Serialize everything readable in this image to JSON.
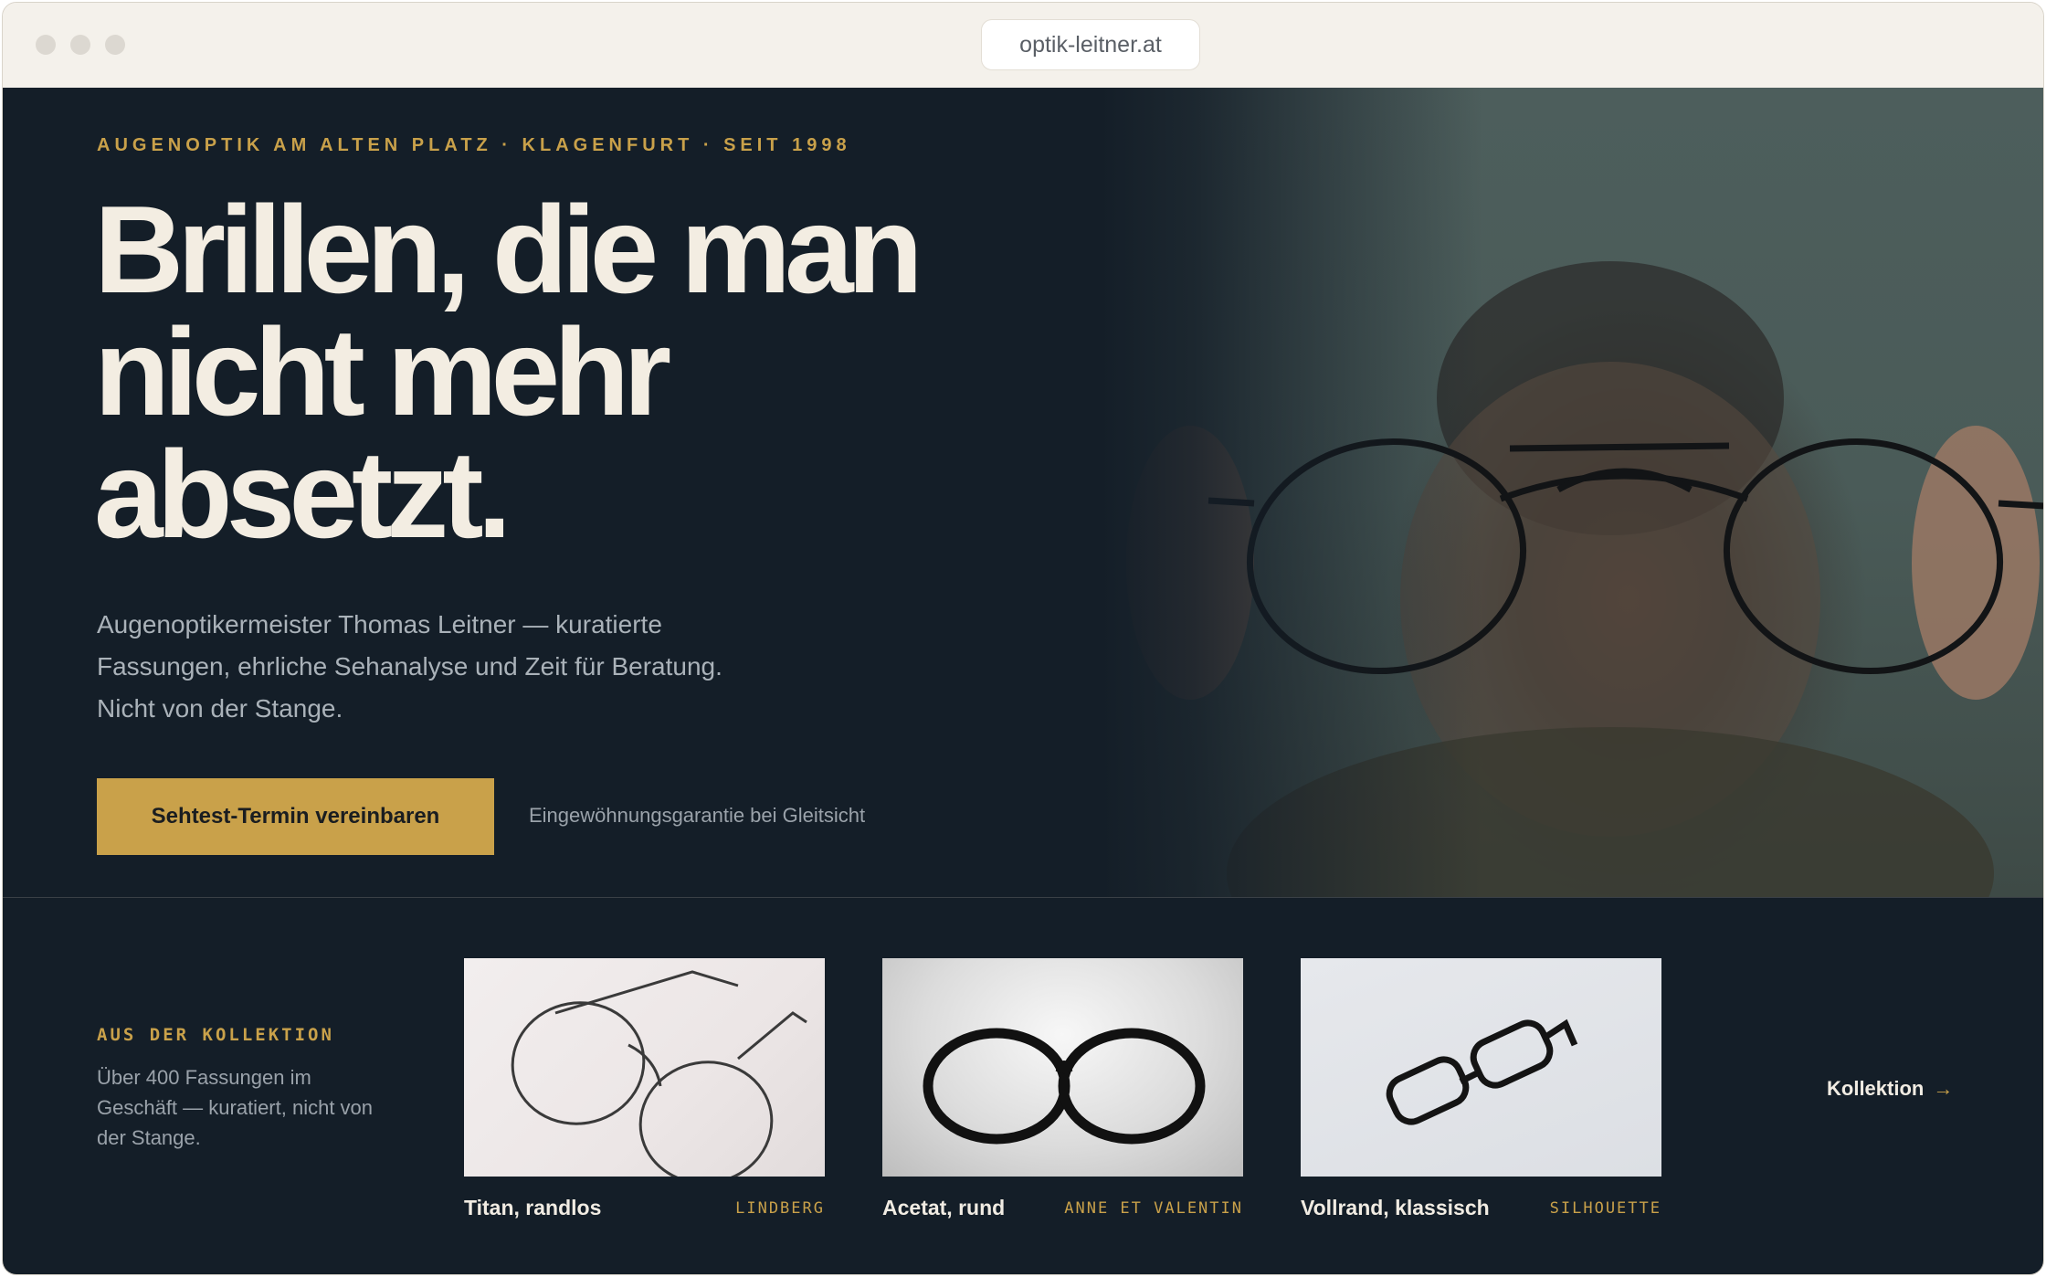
{
  "browser": {
    "url": "optik-leitner.at"
  },
  "hero": {
    "eyebrow": "AUGENOPTIK AM ALTEN PLATZ · KLAGENFURT · SEIT 1998",
    "headline_line1": "Brillen, die man",
    "headline_line2": "nicht mehr",
    "headline_line3": "absetzt.",
    "lede_line1": "Augenoptikermeister Thomas Leitner — kuratierte",
    "lede_line2": "Fassungen, ehrliche Sehanalyse und Zeit für Beratung.",
    "lede_line3": "Nicht von der Stange.",
    "cta_label": "Sehtest-Termin vereinbaren",
    "cta_note": "Eingewöhnungsgarantie bei Gleitsicht"
  },
  "collection": {
    "eyebrow": "AUS DER KOLLEKTION",
    "text_line1": "Über 400 Fassungen im",
    "text_line2": "Geschäft — kuratiert, nicht von",
    "text_line3": "der Stange.",
    "cards": [
      {
        "name": "Titan, randlos",
        "brand": "LINDBERG"
      },
      {
        "name": "Acetat, rund",
        "brand": "ANNE ET VALENTIN"
      },
      {
        "name": "Vollrand, klassisch",
        "brand": "SILHOUETTE"
      }
    ],
    "link_label": "Kollektion",
    "link_icon": "arrow-right-icon"
  },
  "colors": {
    "background": "#141e28",
    "accent": "#c9a14a",
    "headline": "#f3ede2"
  }
}
